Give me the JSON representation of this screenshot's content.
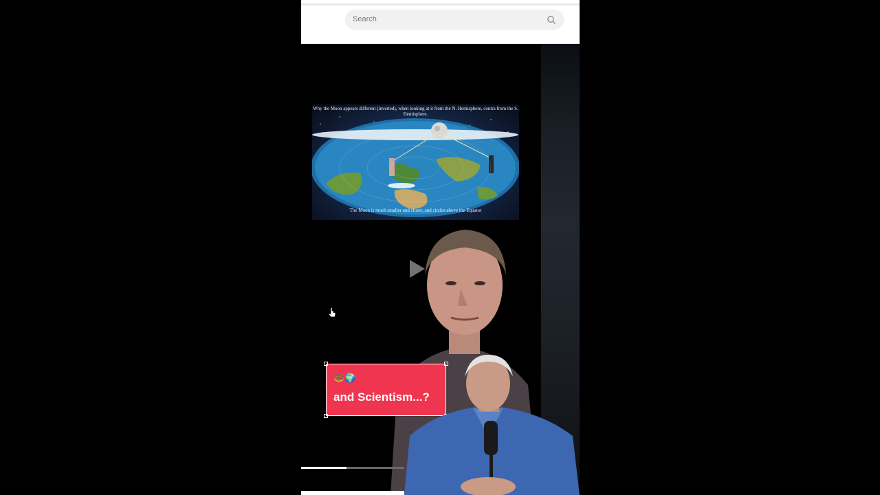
{
  "search": {
    "placeholder": "Search"
  },
  "map_image": {
    "caption_top": "Why the Moon appears different (inverted), when looking at it from the N. Hemisphere, contra from the S. Hemisphere.",
    "caption_bottom": "The Moon is much smaller and closer, and circles above the Equator"
  },
  "sticker": {
    "emoji": "🍩🌍",
    "text": "and Scientism...?"
  },
  "progress": {
    "value": 0.44
  },
  "icons": [
    "search-icon",
    "play-icon",
    "cursor-icon"
  ],
  "colors": {
    "sticker_bg": "#f03550",
    "header_bg": "#ffffff",
    "page_bg": "#000000"
  }
}
